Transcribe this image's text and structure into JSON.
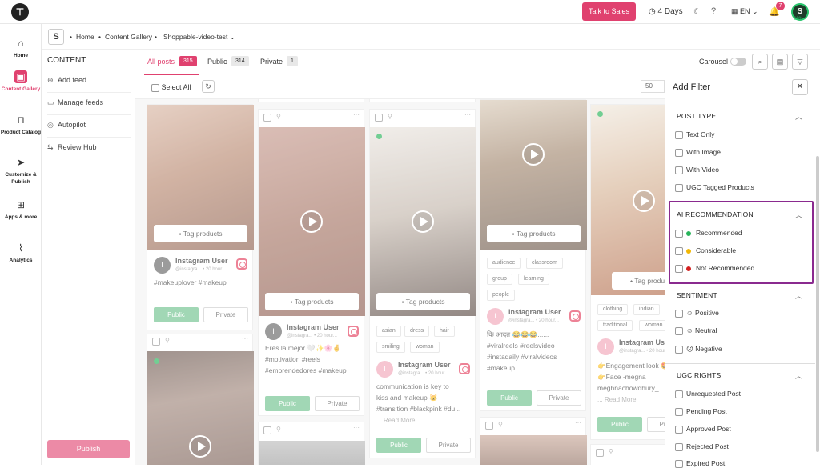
{
  "topbar": {
    "talk_label": "Talk to Sales",
    "trial_days": "4 Days",
    "language": "EN",
    "notification_count": "7",
    "avatar_letter": "S",
    "profile_percent": "60%"
  },
  "sidenav": {
    "items": [
      {
        "label": "Home",
        "icon": "home-icon"
      },
      {
        "label": "Content Gallery",
        "icon": "gallery-icon"
      },
      {
        "label": "Product Catalog",
        "icon": "bag-icon"
      },
      {
        "label": "Customize & Publish",
        "icon": "send-icon"
      },
      {
        "label": "Apps & more",
        "icon": "grid-icon"
      },
      {
        "label": "Analytics",
        "icon": "chart-icon"
      }
    ]
  },
  "breadcrumb": {
    "workspace": "S",
    "items": [
      "Home",
      "Content Gallery",
      "Shoppable-video-test"
    ]
  },
  "content_panel": {
    "title": "CONTENT",
    "items": [
      "Add feed",
      "Manage feeds",
      "Autopilot",
      "Review Hub"
    ],
    "publish_label": "Publish"
  },
  "tabs": [
    {
      "label": "All posts",
      "count": "315"
    },
    {
      "label": "Public",
      "count": "314"
    },
    {
      "label": "Private",
      "count": "1"
    }
  ],
  "toolbar": {
    "carousel_label": "Carousel",
    "select_all": "Select All",
    "page_size": "50"
  },
  "cards": {
    "tag_label": "Tag products",
    "user_name": "Instagram User",
    "user_handle": "@instagra... • 20 hour...",
    "public_label": "Public",
    "private_label": "Private",
    "read_more": "... Read More",
    "c1_caption": "#makeuplover #makeup",
    "c2_caption1": "Eres la mejor 🤍✨🌸🤞",
    "c2_caption2": "#motivation #reels",
    "c2_caption3": "#emprendedores #makeup",
    "c3_tags": [
      "asian",
      "dress",
      "hair",
      "smiling",
      "woman"
    ],
    "c3_caption1": "communication is key to",
    "c3_caption2": "kiss and makeup 🐱",
    "c3_caption3": "#transition #blackpink #du...",
    "c4_tags": [
      "audience",
      "classroom",
      "group",
      "learning",
      "people"
    ],
    "c4_caption1": "कि आदत 😂😂😂......",
    "c4_caption2": "#viralreels #reelsvideo",
    "c4_caption3": "#instadaily #viralvideos",
    "c4_caption4": "#makeup",
    "c5_tags": [
      "clothing",
      "indian",
      "traditional",
      "woman"
    ],
    "c5_caption1": "👉Engagement look 🤩",
    "c5_caption2": "👉Face -megna",
    "c5_caption3": "meghnachowdhury_...",
    "c5_user": "Instagram Us"
  },
  "filter": {
    "title": "Add Filter",
    "post_type": {
      "title": "POST TYPE",
      "options": [
        "Text Only",
        "With Image",
        "With Video",
        "UGC Tagged Products"
      ]
    },
    "ai_recommendation": {
      "title": "AI RECOMMENDATION",
      "options": [
        {
          "label": "Recommended",
          "color": "#27b45a"
        },
        {
          "label": "Considerable",
          "color": "#f2b705"
        },
        {
          "label": "Not Recommended",
          "color": "#d42020"
        }
      ]
    },
    "sentiment": {
      "title": "SENTIMENT",
      "options": [
        "Positive",
        "Neutral",
        "Negative"
      ]
    },
    "ugc_rights": {
      "title": "UGC RIGHTS",
      "options": [
        "Unrequested Post",
        "Pending Post",
        "Approved Post",
        "Rejected Post",
        "Expired Post"
      ]
    }
  },
  "colors": {
    "accent": "#e0416f",
    "ai_box_border": "#8a2a8f",
    "public_button": "#6fc28e"
  }
}
